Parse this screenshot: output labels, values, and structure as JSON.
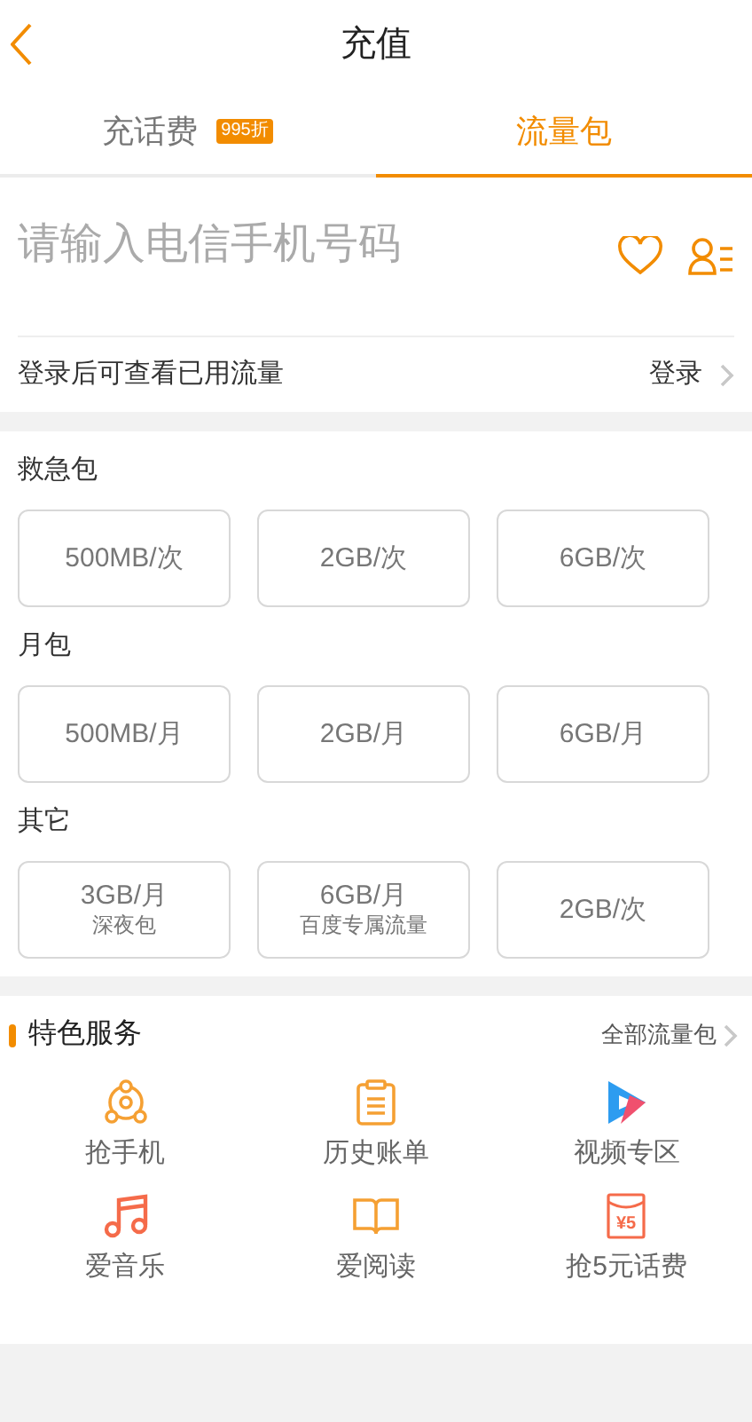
{
  "header": {
    "title": "充值"
  },
  "tabs": [
    {
      "label": "充话费",
      "badge": "995折",
      "selected": false
    },
    {
      "label": "流量包",
      "selected": true
    }
  ],
  "phone_input": {
    "placeholder": "请输入电信手机号码"
  },
  "login_row": {
    "text": "登录后可查看已用流量",
    "action": "登录"
  },
  "groups": [
    {
      "title": "救急包",
      "options": [
        {
          "label": "500MB/次",
          "selected": false
        },
        {
          "label": "2GB/次",
          "selected": false
        },
        {
          "label": "6GB/次",
          "selected": false
        }
      ]
    },
    {
      "title": "月包",
      "options": [
        {
          "label": "500MB/月",
          "selected": false
        },
        {
          "label": "2GB/月",
          "selected": false
        },
        {
          "label": "6GB/月",
          "selected": false
        }
      ]
    },
    {
      "title": "其它",
      "options": [
        {
          "label": "3GB/月",
          "sub": "深夜包",
          "selected": false
        },
        {
          "label": "6GB/月",
          "sub": "百度专属流量",
          "selected": false
        },
        {
          "label": "2GB/次",
          "selected": false
        }
      ]
    }
  ],
  "services": {
    "title": "特色服务",
    "more": "全部流量包",
    "items": [
      {
        "kind": "phone",
        "label": "抢手机"
      },
      {
        "kind": "bill",
        "label": "历史账单"
      },
      {
        "kind": "video",
        "label": "视频专区"
      },
      {
        "kind": "music",
        "label": "爱音乐"
      },
      {
        "kind": "read",
        "label": "爱阅读"
      },
      {
        "kind": "coupon",
        "label": "抢5元话费",
        "icon_text": "¥5"
      }
    ]
  }
}
